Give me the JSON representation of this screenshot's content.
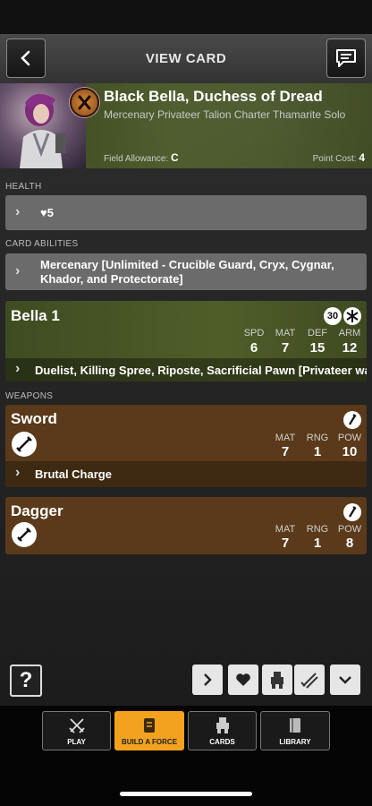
{
  "header": {
    "title": "VIEW CARD",
    "back_icon": "chevron-left-icon",
    "chat_icon": "chat-icon"
  },
  "card": {
    "name": "Black Bella, Duchess of Dread",
    "subtitle": "Mercenary Privateer Talion Charter Thamarite Solo",
    "field_allowance_label": "Field Allowance:",
    "field_allowance": "C",
    "point_cost_label": "Point Cost:",
    "point_cost": "4"
  },
  "sections": {
    "health_label": "HEALTH",
    "health_value": "5",
    "abilities_label": "CARD ABILITIES",
    "abilities_text": "Mercenary [Unlimited - Crucible Guard, Cryx, Cygnar, Khador, and Protectorate]",
    "weapons_label": "WEAPONS"
  },
  "model": {
    "name": "Bella 1",
    "base": "30",
    "stats": [
      {
        "label": "SPD",
        "value": "6"
      },
      {
        "label": "MAT",
        "value": "7"
      },
      {
        "label": "DEF",
        "value": "15"
      },
      {
        "label": "ARM",
        "value": "12"
      }
    ],
    "rules": "Duelist, Killing Spree, Riposte, Sacrificial Pawn [Privateer warr"
  },
  "weapons": [
    {
      "name": "Sword",
      "stats": [
        {
          "label": "MAT",
          "value": "7"
        },
        {
          "label": "RNG",
          "value": "1"
        },
        {
          "label": "POW",
          "value": "10"
        }
      ],
      "rule": "Brutal Charge"
    },
    {
      "name": "Dagger",
      "stats": [
        {
          "label": "MAT",
          "value": "7"
        },
        {
          "label": "RNG",
          "value": "1"
        },
        {
          "label": "POW",
          "value": "8"
        }
      ]
    }
  ],
  "toolbar": {
    "help": "?"
  },
  "nav": [
    {
      "label": "PLAY",
      "icon": "crossed-swords-icon"
    },
    {
      "label": "BUILD A FORCE",
      "icon": "scroll-icon"
    },
    {
      "label": "CARDS",
      "icon": "robot-icon"
    },
    {
      "label": "LIBRARY",
      "icon": "book-icon"
    }
  ],
  "colors": {
    "nav_active": "#f2a21e",
    "faction_green": "#4b5a2a",
    "weapon_brown": "#5a3a1a"
  }
}
